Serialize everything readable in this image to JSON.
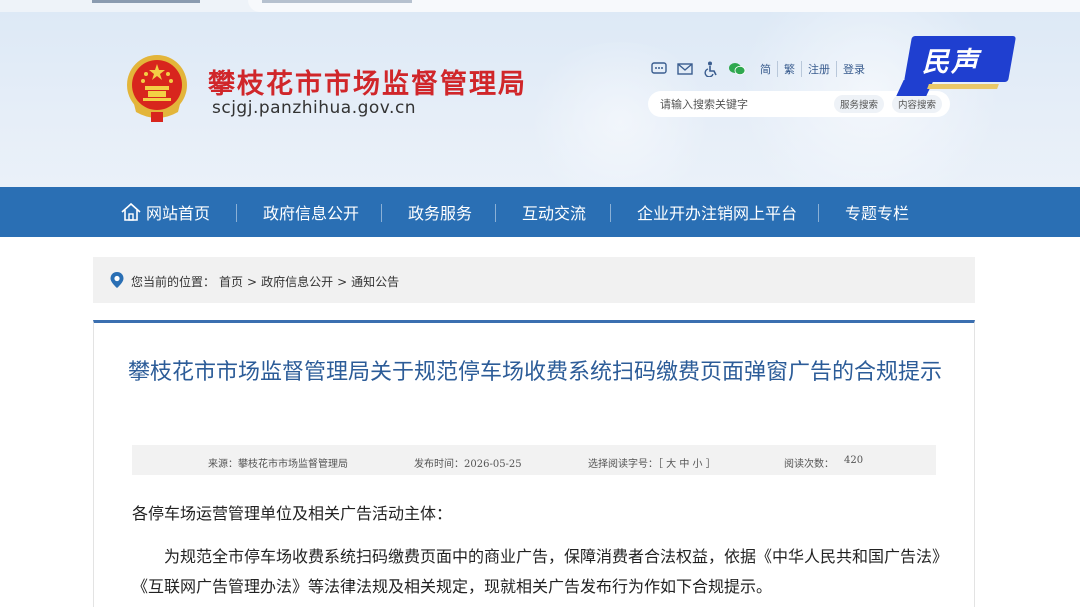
{
  "colors": {
    "brand_red": "#d0262a",
    "nav_blue": "#2a6fb4",
    "title_blue": "#2c5c98",
    "badge_blue": "#1f3fd0"
  },
  "header": {
    "site_name": "攀枝花市市场监督管理局",
    "domain": "scjgj.panzhihua.gov.cn",
    "utilities": {
      "icons": [
        "message-icon",
        "mail-icon",
        "accessibility-icon",
        "wechat-icon"
      ],
      "links": [
        "简",
        "繁",
        "注册",
        "登录"
      ]
    },
    "search": {
      "placeholder": "请输入搜索关键字",
      "site_search": "服务搜索",
      "content_search": "内容搜索"
    }
  },
  "badge": {
    "label": "民声"
  },
  "nav": {
    "home_icon": "home-icon",
    "items": [
      "网站首页",
      "政府信息公开",
      "政务服务",
      "互动交流",
      "企业开办注销网上平台",
      "专题专栏"
    ]
  },
  "breadcrumb": {
    "prefix": "您当前的位置：",
    "items": [
      "首页",
      "政府信息公开",
      "通知公告"
    ],
    "separator": ">"
  },
  "article": {
    "title": "攀枝花市市场监督管理局关于规范停车场收费系统扫码缴费页面弹窗广告的合规提示",
    "meta": {
      "source": "来源：攀枝花市市场监督管理局",
      "published": "发布时间：2026-05-25",
      "font_size": "选择阅读字号：［ 大 中 小 ］",
      "views_label": "阅读次数：",
      "views": "420"
    },
    "salutation": "各停车场运营管理单位及相关广告活动主体：",
    "paragraph": "为规范全市停车场收费系统扫码缴费页面中的商业广告，保障消费者合法权益，依据《中华人民共和国广告法》《互联网广告管理办法》等法律法规及相关规定，现就相关广告发布行为作如下合规提示。"
  }
}
